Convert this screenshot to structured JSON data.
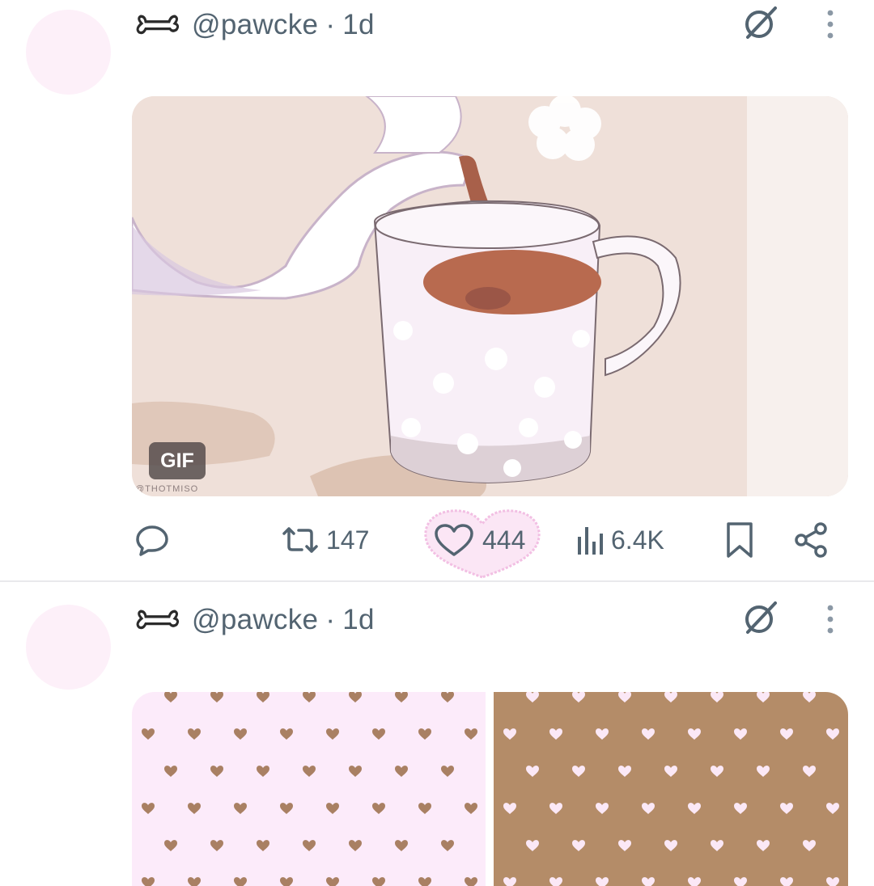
{
  "posts": [
    {
      "author_handle": "@pawcke",
      "separator": "·",
      "time": "1d",
      "media": {
        "badge": "GIF",
        "watermark": "@THOTMISO"
      },
      "actions": {
        "replies": "",
        "reposts": "147",
        "likes": "444",
        "views": "6.4K"
      },
      "liked": true
    },
    {
      "author_handle": "@pawcke",
      "separator": "·",
      "time": "1d"
    }
  ],
  "icons": {
    "author_icon": "bone-icon",
    "grok": "grok-icon",
    "more": "more-vertical-icon",
    "reply": "reply-icon",
    "repost": "repost-icon",
    "like": "heart-icon",
    "views": "views-icon",
    "bookmark": "bookmark-icon",
    "share": "share-icon"
  },
  "colors": {
    "text_muted": "#536471",
    "avatar_bg": "#fdf0f9",
    "like_highlight": "#f7d6ee",
    "pattern_pink": "#fcebfa",
    "pattern_brown": "#b48c68"
  }
}
